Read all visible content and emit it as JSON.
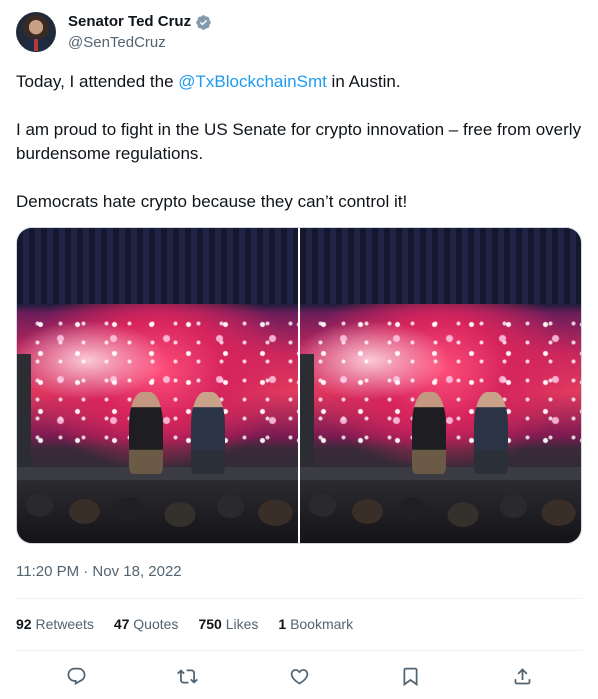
{
  "author": {
    "display_name": "Senator Ted Cruz",
    "handle": "@SenTedCruz",
    "verified": true,
    "verified_color": "#71767b"
  },
  "tweet": {
    "line1_before": "Today, I attended the ",
    "line1_mention": "@TxBlockchainSmt",
    "line1_after": " in Austin.",
    "paragraph2": "I am proud to fight in the US Senate for crypto innovation – free from overly burdensome regulations.",
    "paragraph3": "Democrats hate crypto because they can’t control it!"
  },
  "timestamp": "11:20 PM · Nov 18, 2022",
  "stats": {
    "retweets_count": "92",
    "retweets_label": "Retweets",
    "quotes_count": "47",
    "quotes_label": "Quotes",
    "likes_count": "750",
    "likes_label": "Likes",
    "bookmarks_count": "1",
    "bookmarks_label": "Bookmark"
  },
  "actions": [
    "reply-icon",
    "retweet-icon",
    "like-icon",
    "bookmark-icon",
    "share-icon"
  ],
  "colors": {
    "accent": "#1d9bf0",
    "secondary_text": "#536471",
    "primary_text": "#0f1419"
  }
}
